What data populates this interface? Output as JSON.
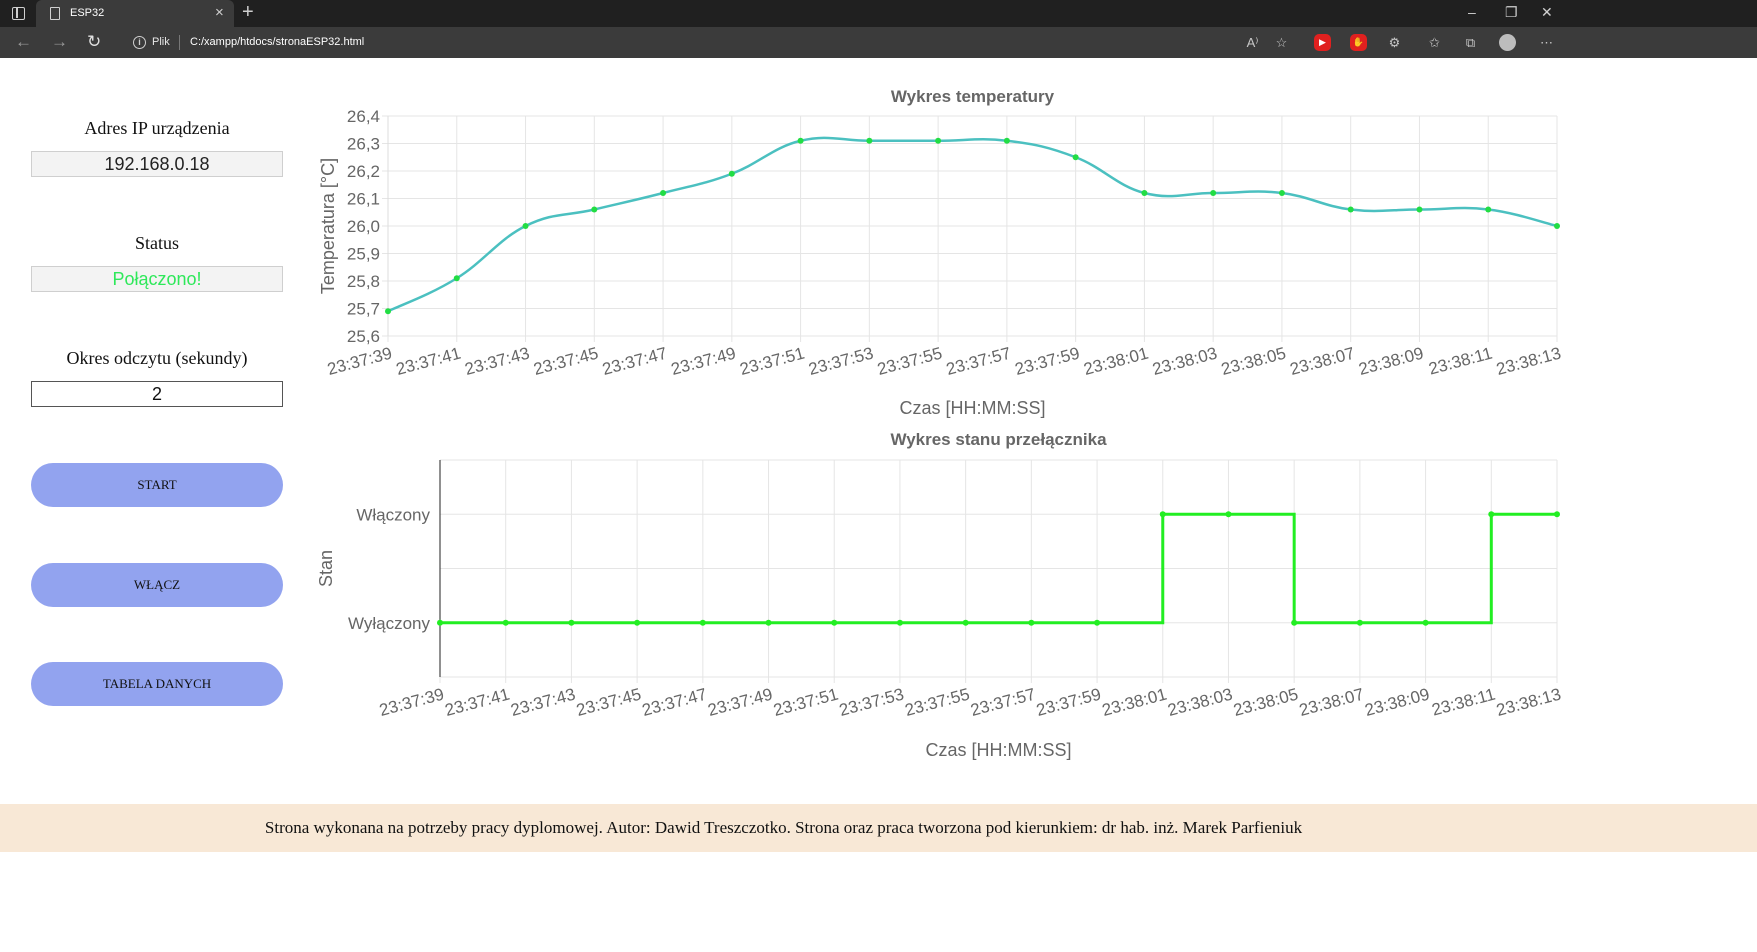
{
  "browser": {
    "tab_title": "ESP32",
    "tab_close": "×",
    "new_tab": "+",
    "window": {
      "minimize": "–",
      "restore": "❐",
      "close": "✕"
    },
    "nav": {
      "back": "←",
      "forward": "→",
      "reload": "↻"
    },
    "info": "i",
    "scheme_label": "Plik",
    "url": "C:/xampp/htdocs/stronaESP32.html",
    "toolbar_icons": [
      "read-aloud-icon",
      "favorite-add-icon",
      "youtube-extension-icon",
      "adblock-extension-icon",
      "extensions-icon",
      "favorites-icon",
      "collections-icon",
      "profile-avatar-icon",
      "more-icon"
    ],
    "toolbar_glyphs": {
      "read_aloud": "A⁾",
      "favorite_add": "☆",
      "youtube": "▶",
      "adblock": "✋",
      "extensions": "⚙",
      "favorites": "✩",
      "collections": "⧉",
      "more": "⋯"
    }
  },
  "panel": {
    "ip_label": "Adres IP urządzenia",
    "ip_value": "192.168.0.18",
    "status_label": "Status",
    "status_value": "Połączono!",
    "status_color": "#2ee85a",
    "period_label": "Okres odczytu (sekundy)",
    "period_value": "2",
    "buttons": {
      "start": "START",
      "toggle": "WŁĄCZ",
      "table": "TABELA DANYCH"
    },
    "button_color": "#92a3ef"
  },
  "footer": {
    "text": "Strona wykonana na potrzeby pracy dyplomowej. Autor: Dawid Treszczotko. Strona oraz praca tworzona pod kierunkiem: dr hab. inż. Marek Parfieniuk"
  },
  "chart_data": [
    {
      "type": "line",
      "title": "Wykres temperatury",
      "xlabel": "Czas [HH:MM:SS]",
      "ylabel": "Temperatura [°C]",
      "categories": [
        "23:37:39",
        "23:37:41",
        "23:37:43",
        "23:37:45",
        "23:37:47",
        "23:37:49",
        "23:37:51",
        "23:37:53",
        "23:37:55",
        "23:37:57",
        "23:37:59",
        "23:38:01",
        "23:38:03",
        "23:38:05",
        "23:38:07",
        "23:38:09",
        "23:38:11",
        "23:38:13"
      ],
      "series": [
        {
          "values": [
            25.69,
            25.81,
            26.0,
            26.06,
            26.12,
            26.19,
            26.31,
            26.31,
            26.31,
            26.31,
            26.25,
            26.12,
            26.12,
            26.12,
            26.06,
            26.06,
            26.06,
            26.0
          ],
          "color": "#4bc0c0",
          "point_color": "#22dd44"
        }
      ],
      "yticks": [
        "25,6",
        "25,7",
        "25,8",
        "25,9",
        "26,0",
        "26,1",
        "26,2",
        "26,3",
        "26,4"
      ],
      "ylim": [
        25.6,
        26.4
      ],
      "grid": true
    },
    {
      "type": "line",
      "title": "Wykres stanu przełącznika",
      "xlabel": "Czas [HH:MM:SS]",
      "ylabel": "Stan",
      "categories": [
        "23:37:39",
        "23:37:41",
        "23:37:43",
        "23:37:45",
        "23:37:47",
        "23:37:49",
        "23:37:51",
        "23:37:53",
        "23:37:55",
        "23:37:57",
        "23:37:59",
        "23:38:01",
        "23:38:03",
        "23:38:05",
        "23:38:07",
        "23:38:09",
        "23:38:11",
        "23:38:13"
      ],
      "series": [
        {
          "values": [
            0,
            0,
            0,
            0,
            0,
            0,
            0,
            0,
            0,
            0,
            0,
            1,
            1,
            0,
            0,
            0,
            1,
            1
          ],
          "color": "#22ee22",
          "stepped": true
        }
      ],
      "ytick_labels": [
        "Wyłączony",
        "Włączony"
      ],
      "ylim": [
        -0.5,
        1.5
      ],
      "grid": true
    }
  ]
}
